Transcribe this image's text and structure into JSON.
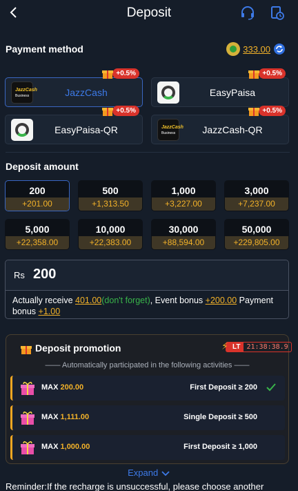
{
  "header": {
    "title": "Deposit"
  },
  "payment": {
    "title": "Payment method",
    "balance": "333.00",
    "methods": [
      {
        "label": "JazzCash",
        "bonus": "+0.5%"
      },
      {
        "label": "EasyPaisa",
        "bonus": "+0.5%"
      },
      {
        "label": "EasyPaisa-QR",
        "bonus": "+0.5%"
      },
      {
        "label": "JazzCash-QR",
        "bonus": "+0.5%"
      }
    ],
    "logo_text": {
      "brand": "JazzCash",
      "sub": "Business"
    }
  },
  "deposit": {
    "title": "Deposit amount",
    "options": [
      {
        "value": "200",
        "bonus": "+201.00"
      },
      {
        "value": "500",
        "bonus": "+1,313.50"
      },
      {
        "value": "1,000",
        "bonus": "+3,227.00"
      },
      {
        "value": "3,000",
        "bonus": "+7,237.00"
      },
      {
        "value": "5,000",
        "bonus": "+22,358.00"
      },
      {
        "value": "10,000",
        "bonus": "+22,383.00"
      },
      {
        "value": "30,000",
        "bonus": "+88,594.00"
      },
      {
        "value": "50,000",
        "bonus": "+229,805.00"
      }
    ],
    "currency": "Rs",
    "amount": "200",
    "receive": {
      "t1": "Actually receive ",
      "v1": "401.00",
      "t2": "(don't forget)",
      "t3": ", Event bonus ",
      "v2": "+200.00",
      "t4": " Payment bonus ",
      "v3": "+1.00"
    }
  },
  "promotion": {
    "title": "Deposit promotion",
    "lt": "LT",
    "timer": "21:38:38.9",
    "subtitle": "—— Automatically participated in the following activities ——",
    "rows": [
      {
        "max_label": "MAX",
        "max_value": "200.00",
        "condition": "First Deposit ≥ 200"
      },
      {
        "max_label": "MAX",
        "max_value": "1,111.00",
        "condition": "Single Deposit ≥ 500"
      },
      {
        "max_label": "MAX",
        "max_value": "1,000.00",
        "condition": "First Deposit ≥ 1,000"
      }
    ]
  },
  "expand_label": "Expand",
  "reminder": "Reminder:If the recharge is unsuccessful, please choose another"
}
